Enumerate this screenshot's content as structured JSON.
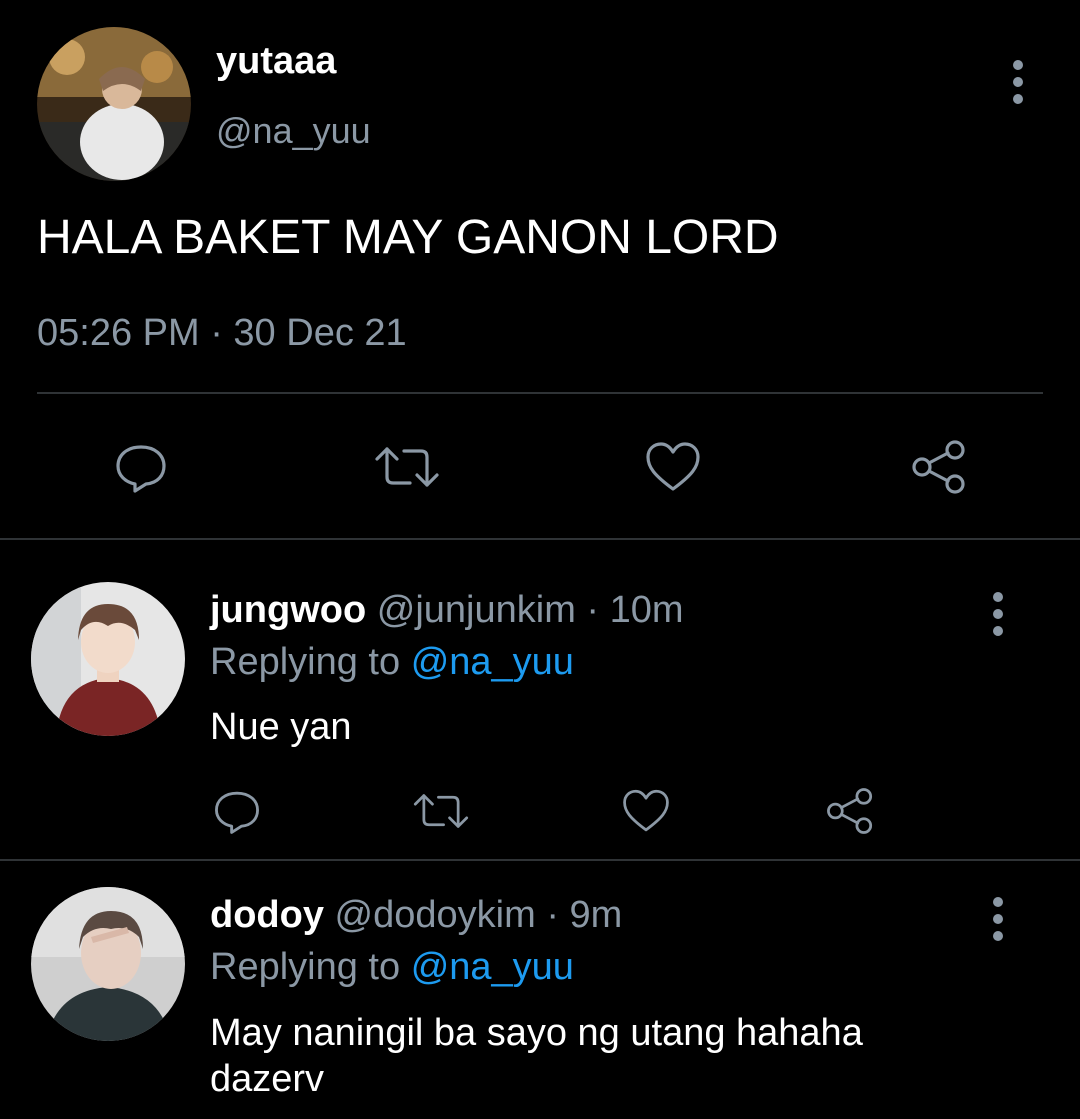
{
  "main_tweet": {
    "display_name": "yutaaa",
    "handle": "@na_yuu",
    "text": "HALA BAKET MAY GANON LORD",
    "timestamp": "05:26 PM · 30 Dec 21",
    "actions": [
      "comment-icon",
      "retweet-icon",
      "heart-icon",
      "share-icon"
    ]
  },
  "replies": [
    {
      "display_name": "jungwoo",
      "handle": "@junjunkim",
      "time": "· 10m",
      "replying_prefix": "Replying to",
      "replying_to": "@na_yuu",
      "text": "Nue yan"
    },
    {
      "display_name": "dodoy",
      "handle": "@dodoykim",
      "time": "· 9m",
      "replying_prefix": "Replying to",
      "replying_to": "@na_yuu",
      "text": "May naningil ba sayo ng utang hahaha dazerv"
    }
  ],
  "colors": {
    "background": "#000000",
    "text_primary": "#e7e9ea",
    "text_secondary": "#8b98a5",
    "link": "#1d9bf0",
    "divider": "#2f3336"
  }
}
